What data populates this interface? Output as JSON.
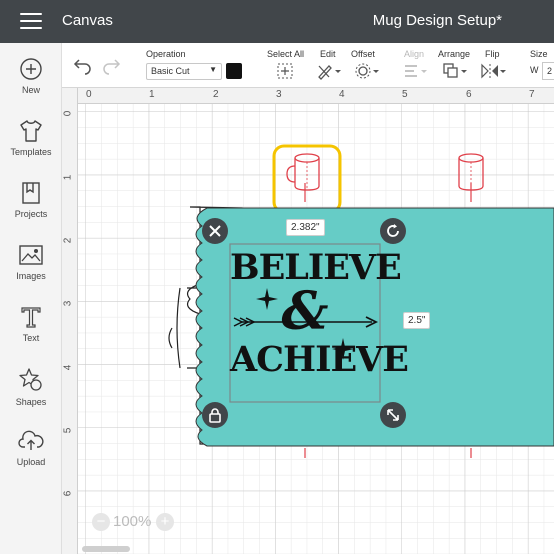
{
  "app": {
    "title": "Canvas",
    "project_name": "Mug Design Setup*"
  },
  "toolbar": {
    "operation_label": "Operation",
    "operation_value": "Basic Cut",
    "operation_color": "#111111",
    "select_all_label": "Select All",
    "edit_label": "Edit",
    "offset_label": "Offset",
    "align_label": "Align",
    "arrange_label": "Arrange",
    "flip_label": "Flip",
    "size_label": "Size",
    "size_w_label": "W",
    "size_w_value": "2"
  },
  "sidebar": {
    "items": [
      {
        "label": "New",
        "icon": "plus-circle-icon"
      },
      {
        "label": "Templates",
        "icon": "shirt-icon"
      },
      {
        "label": "Projects",
        "icon": "bookmark-icon"
      },
      {
        "label": "Images",
        "icon": "image-icon"
      },
      {
        "label": "Text",
        "icon": "text-t-icon"
      },
      {
        "label": "Shapes",
        "icon": "shapes-icon"
      },
      {
        "label": "Upload",
        "icon": "cloud-upload-icon"
      }
    ]
  },
  "canvas": {
    "ruler_top": [
      "0",
      "1",
      "2",
      "3",
      "4",
      "5",
      "6",
      "7"
    ],
    "ruler_left": [
      "0",
      "1",
      "2",
      "3",
      "4",
      "5",
      "6"
    ],
    "width_dimension": "2.382\"",
    "height_dimension": "2.5\"",
    "zoom_level": "100%",
    "design_text_line1": "BELIEVE",
    "design_text_line2": "&",
    "design_text_line3": "ACHIEVE",
    "mug_color": "#66ccc6",
    "accent_color": "#f5c400",
    "guide_color": "#e0404a"
  }
}
